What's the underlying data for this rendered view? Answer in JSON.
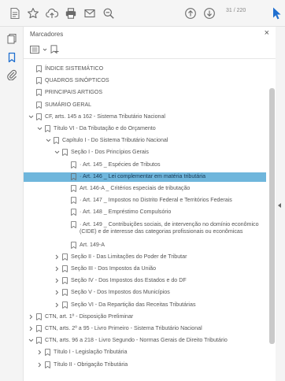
{
  "toolbar": {
    "page_indicator": "31 / 220",
    "icons": [
      "document-icon",
      "star-icon",
      "upload-icon",
      "print-icon",
      "email-icon",
      "zoom-icon",
      "page-up-icon",
      "page-down-icon",
      "cursor-icon"
    ]
  },
  "rail": {
    "icons": [
      "pages-icon",
      "bookmarks-icon",
      "attachment-icon"
    ]
  },
  "panel": {
    "title": "Marcadores",
    "close_label": "×"
  },
  "bookmarks": [
    {
      "label": "ÍNDICE SISTEMÁTICO",
      "depth": 0,
      "chevron": "none"
    },
    {
      "label": "QUADROS SINÓPTICOS",
      "depth": 0,
      "chevron": "none"
    },
    {
      "label": "PRINCIPAIS ARTIGOS",
      "depth": 0,
      "chevron": "none"
    },
    {
      "label": "SUMÁRIO GERAL",
      "depth": 0,
      "chevron": "none"
    },
    {
      "label": "CF, arts. 145 a 162 - Sistema Tributário Nacional",
      "depth": 0,
      "chevron": "down"
    },
    {
      "label": "Título VI - Da Tributação e do Orçamento",
      "depth": 1,
      "chevron": "down"
    },
    {
      "label": "Capítulo I - Do Sistema Tributário Nacional",
      "depth": 2,
      "chevron": "down"
    },
    {
      "label": "Seção I - Dos Princípios Gerais",
      "depth": 3,
      "chevron": "down"
    },
    {
      "label": "Art. 145 _ Espécies de Tributos",
      "depth": 4,
      "chevron": "none",
      "bullet": true
    },
    {
      "label": "Art. 146 _ Lei complementar em matéria tributária",
      "depth": 4,
      "chevron": "none",
      "bullet": true,
      "selected": true
    },
    {
      "label": "Art. 146-A _ Critérios especiais de tributação",
      "depth": 4,
      "chevron": "none",
      "bullet": false
    },
    {
      "label": "Art. 147 _ Impostos no Distrito Federal e Territórios Federais",
      "depth": 4,
      "chevron": "none",
      "bullet": true
    },
    {
      "label": "Art. 148 _ Empréstimo Compulsório",
      "depth": 4,
      "chevron": "none",
      "bullet": true
    },
    {
      "label": "Art. 149 _ Contribuições sociais, de intervenção no domínio econômico (CIDE) e de interesse das categorias profissionais ou econômicas",
      "depth": 4,
      "chevron": "none",
      "bullet": true,
      "multiline": true
    },
    {
      "label": "Art. 149-A",
      "depth": 4,
      "chevron": "none",
      "bullet": false
    },
    {
      "label": "Seção II - Das Limitações do Poder de Tributar",
      "depth": 3,
      "chevron": "right"
    },
    {
      "label": "Seção III - Dos Impostos da União",
      "depth": 3,
      "chevron": "right"
    },
    {
      "label": "Seção IV - Dos Impostos dos Estados e do DF",
      "depth": 3,
      "chevron": "right"
    },
    {
      "label": "Seção V - Dos Impostos dos Municípios",
      "depth": 3,
      "chevron": "right"
    },
    {
      "label": "Seção VI - Da Repartição das Receitas Tributárias",
      "depth": 3,
      "chevron": "right"
    },
    {
      "label": "CTN, art. 1º - Disposição Preliminar",
      "depth": 0,
      "chevron": "right"
    },
    {
      "label": "CTN, arts. 2º a 95 - Livro Primeiro - Sistema Tributário Nacional",
      "depth": 0,
      "chevron": "right"
    },
    {
      "label": "CTN, arts. 96 a 218 - Livro Segundo - Normas Gerais de Direito Tributário",
      "depth": 0,
      "chevron": "down"
    },
    {
      "label": "Título I - Legislação Tributária",
      "depth": 1,
      "chevron": "right"
    },
    {
      "label": "Título II - Obrigação Tributária",
      "depth": 1,
      "chevron": "right"
    }
  ],
  "colors": {
    "accent": "#1f6fd0",
    "selected_bg": "#6fb6dc",
    "icon_gray": "#6a6a6a"
  }
}
